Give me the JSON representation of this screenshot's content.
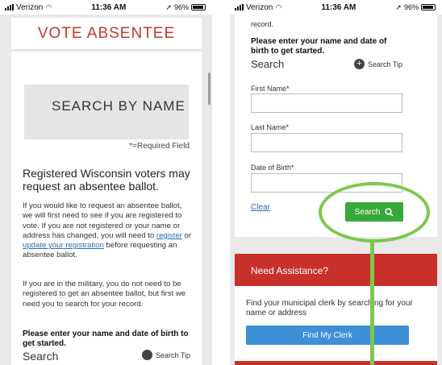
{
  "status_bar": {
    "carrier": "Verizon",
    "time": "11:36 AM",
    "battery": "96%"
  },
  "left_screen": {
    "header_title": "VOTE ABSENTEE",
    "search_box_title": "SEARCH BY NAME",
    "required_note": "*=Required Field",
    "heading": "Registered Wisconsin voters may request an absentee ballot.",
    "para1": {
      "text_a": "If you would like to request an absentee ballot, we will first need to see if you are registered to vote. If you are not registered or your name or address has changed, you will need to ",
      "link_register": "register",
      "text_or": " or ",
      "link_update": "update your registration",
      "text_b": " before requesting an absentee ballot."
    },
    "para2": "If you are in the military, you do not need to be registered to get an absentee ballot, but first we need you to search for your record.",
    "prompt": "Please enter your name and date of birth to get started.",
    "search_label": "Search",
    "search_tip": "Search Tip"
  },
  "right_screen": {
    "record_text": "record.",
    "prompt": "Please enter your name and date of birth to get started.",
    "search_label": "Search",
    "search_tip": "Search Tip",
    "fields": [
      {
        "label": "First Name*",
        "value": ""
      },
      {
        "label": "Last Name*",
        "value": ""
      },
      {
        "label": "Date of Birth*",
        "value": ""
      }
    ],
    "clear_label": "Clear",
    "search_button": "Search",
    "assistance_title": "Need Assistance?",
    "assistance_text": "Find your municipal clerk by searching for your name or address",
    "find_clerk_button": "Find My Clerk"
  },
  "colors": {
    "accent_red": "#c9302c",
    "search_green": "#38a838",
    "link_blue": "#2b6cb0",
    "clerk_blue": "#3d8fd6",
    "annotation_green": "#7cc84a"
  },
  "icons": [
    "signal-icon",
    "wifi-icon",
    "battery-icon",
    "info-icon",
    "search-icon"
  ]
}
